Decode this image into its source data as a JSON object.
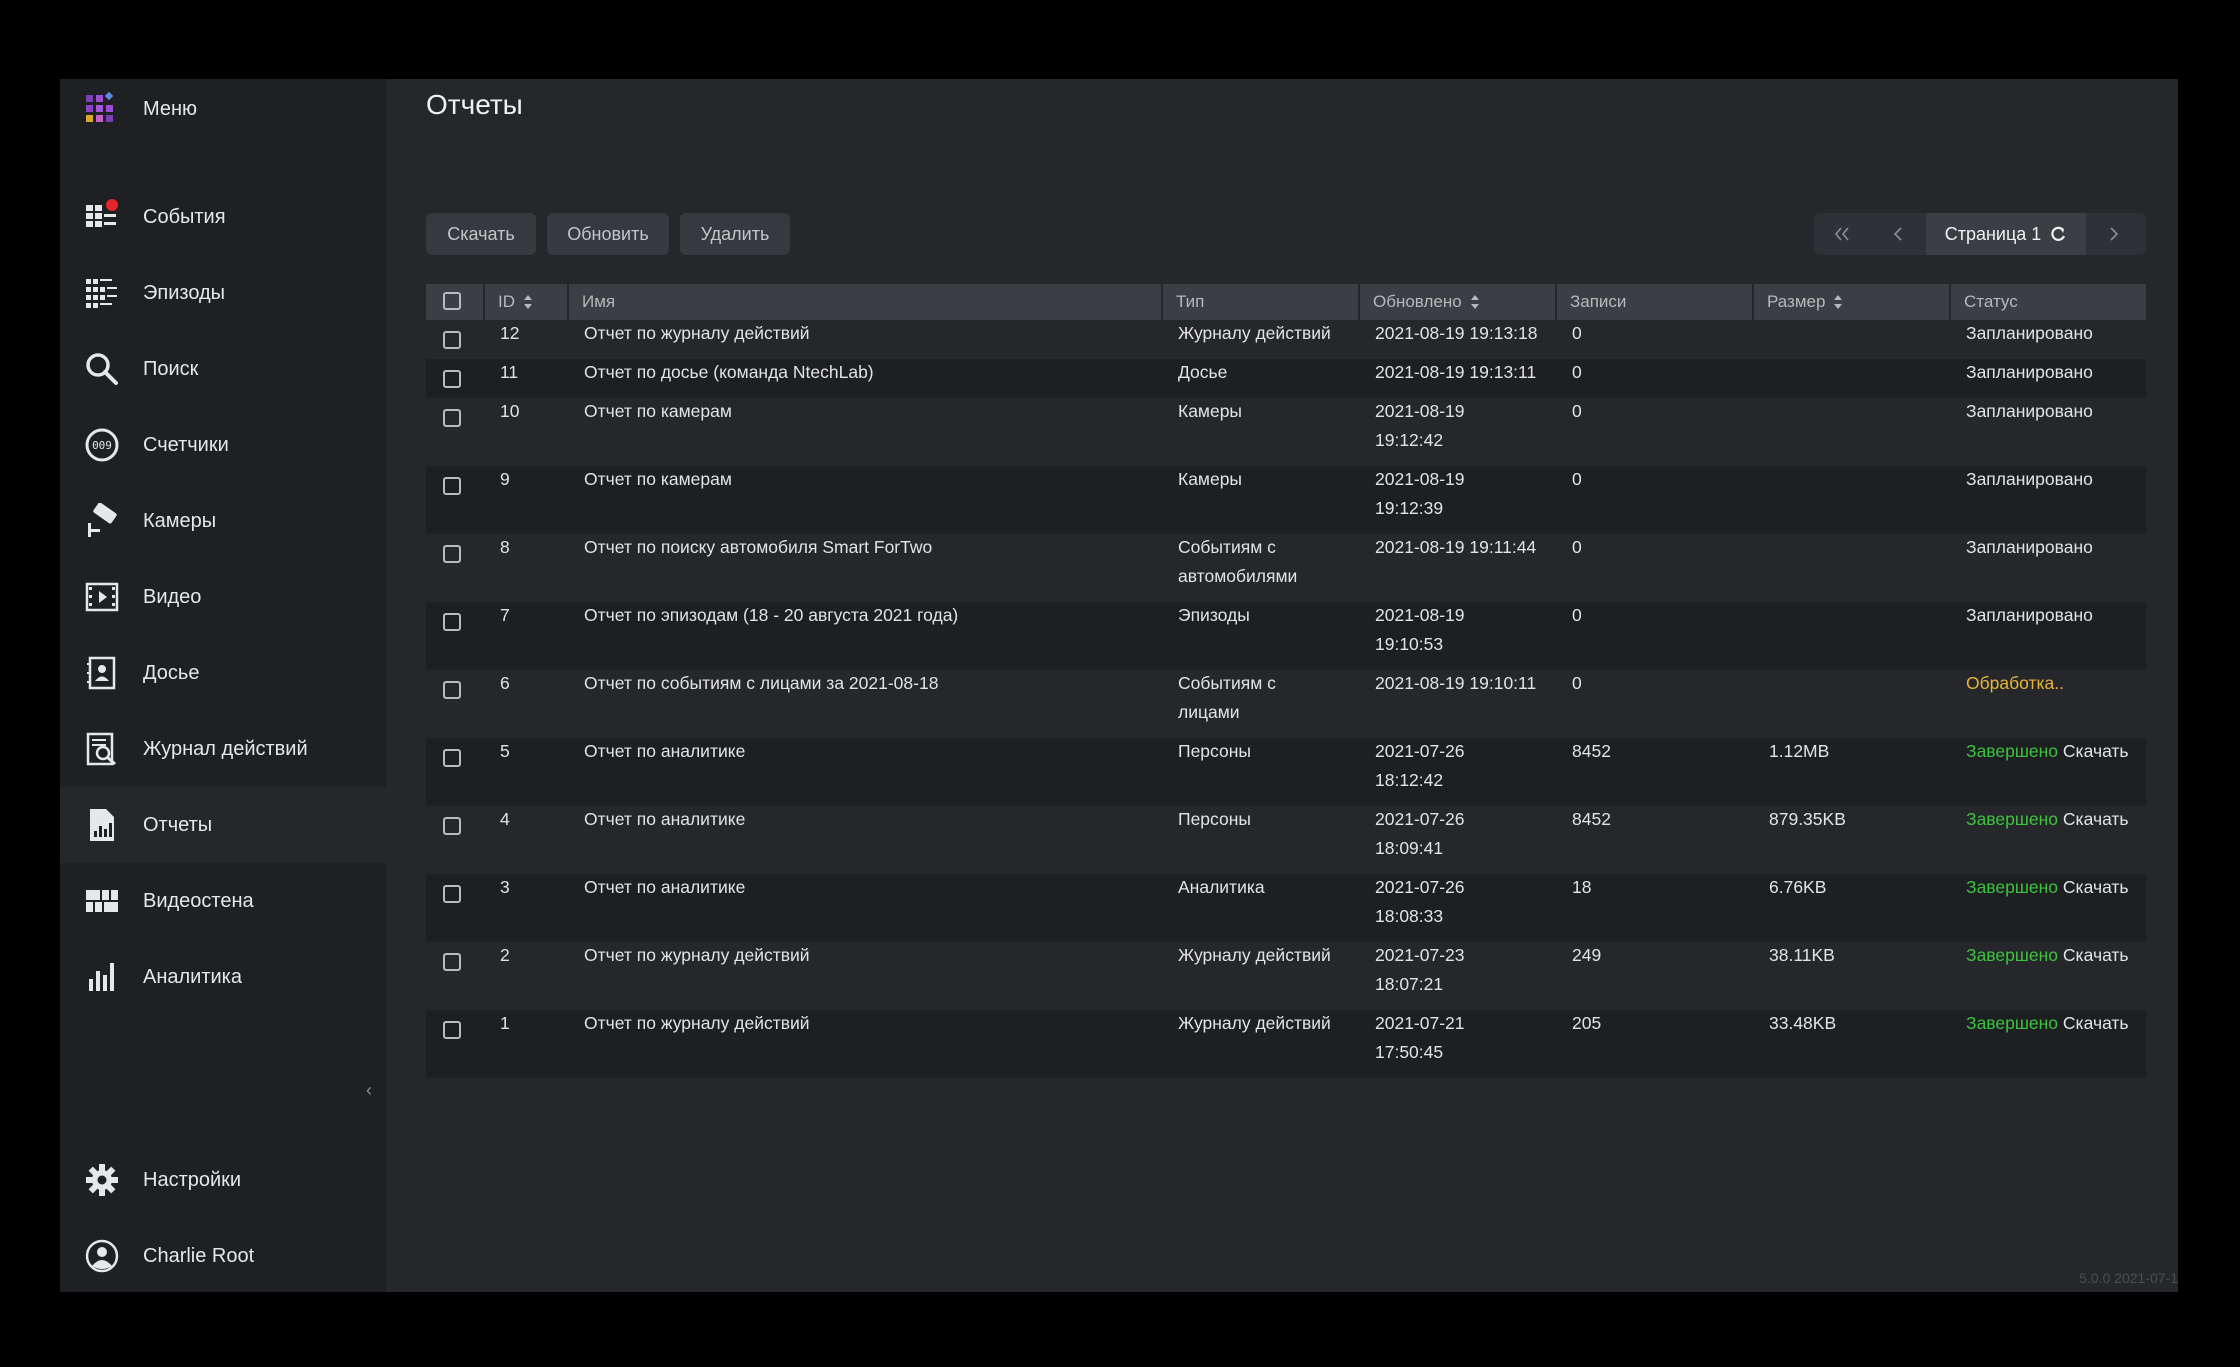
{
  "menu_label": "Меню",
  "sidebar": {
    "items": [
      {
        "key": "events",
        "label": "События",
        "icon": "events-grid-icon",
        "badge": true
      },
      {
        "key": "episodes",
        "label": "Эпизоды",
        "icon": "episodes-icon"
      },
      {
        "key": "search",
        "label": "Поиск",
        "icon": "search-icon"
      },
      {
        "key": "counters",
        "label": "Счетчики",
        "icon": "counter-icon"
      },
      {
        "key": "cameras",
        "label": "Камеры",
        "icon": "camera-icon"
      },
      {
        "key": "video",
        "label": "Видео",
        "icon": "film-icon"
      },
      {
        "key": "dossier",
        "label": "Досье",
        "icon": "dossier-icon"
      },
      {
        "key": "audit",
        "label": "Журнал действий",
        "icon": "audit-log-icon"
      },
      {
        "key": "reports",
        "label": "Отчеты",
        "icon": "report-icon",
        "active": true
      },
      {
        "key": "videowall",
        "label": "Видеостена",
        "icon": "videowall-icon"
      },
      {
        "key": "analytics",
        "label": "Аналитика",
        "icon": "bar-chart-icon"
      }
    ],
    "settings_label": "Настройки",
    "user_label": "Charlie Root"
  },
  "page_title": "Отчеты",
  "toolbar": {
    "download": "Скачать",
    "refresh": "Обновить",
    "delete": "Удалить"
  },
  "pager": {
    "current": "Страница 1"
  },
  "table": {
    "headers": {
      "id": "ID",
      "name": "Имя",
      "type": "Тип",
      "updated": "Обновлено",
      "records": "Записи",
      "size": "Размер",
      "status": "Статус"
    },
    "rows": [
      {
        "id": "12",
        "name": "Отчет по журналу действий",
        "type": [
          "Журналу действий"
        ],
        "updated": [
          "2021-08-19 19:13:18"
        ],
        "records": "0",
        "size": "",
        "status": "Запланировано",
        "status_kind": "planned",
        "link": ""
      },
      {
        "id": "11",
        "name": "Отчет по досье (команда NtechLab)",
        "type": [
          "Досье"
        ],
        "updated": [
          "2021-08-19 19:13:11"
        ],
        "records": "0",
        "size": "",
        "status": "Запланировано",
        "status_kind": "planned",
        "link": ""
      },
      {
        "id": "10",
        "name": "Отчет по камерам",
        "type": [
          "Камеры"
        ],
        "updated": [
          "2021-08-19",
          "19:12:42"
        ],
        "records": "0",
        "size": "",
        "status": "Запланировано",
        "status_kind": "planned",
        "link": ""
      },
      {
        "id": "9",
        "name": "Отчет по камерам",
        "type": [
          "Камеры"
        ],
        "updated": [
          "2021-08-19",
          "19:12:39"
        ],
        "records": "0",
        "size": "",
        "status": "Запланировано",
        "status_kind": "planned",
        "link": ""
      },
      {
        "id": "8",
        "name": "Отчет по поиску автомобиля Smart ForTwo",
        "type": [
          "Событиям с",
          "автомобилями"
        ],
        "updated": [
          "2021-08-19 19:11:44"
        ],
        "records": "0",
        "size": "",
        "status": "Запланировано",
        "status_kind": "planned",
        "link": ""
      },
      {
        "id": "7",
        "name": "Отчет по эпизодам (18 - 20 августа 2021 года)",
        "type": [
          "Эпизоды"
        ],
        "updated": [
          "2021-08-19",
          "19:10:53"
        ],
        "records": "0",
        "size": "",
        "status": "Запланировано",
        "status_kind": "planned",
        "link": ""
      },
      {
        "id": "6",
        "name": "Отчет по событиям с лицами за 2021-08-18",
        "type": [
          "Событиям с",
          "лицами"
        ],
        "updated": [
          "2021-08-19 19:10:11"
        ],
        "records": "0",
        "size": "",
        "status": "Обработка..",
        "status_kind": "processing",
        "link": ""
      },
      {
        "id": "5",
        "name": "Отчет по аналитике",
        "type": [
          "Персоны"
        ],
        "updated": [
          "2021-07-26",
          "18:12:42"
        ],
        "records": "8452",
        "size": "1.12MB",
        "status": "Завершено",
        "status_kind": "done",
        "link": "Скачать"
      },
      {
        "id": "4",
        "name": "Отчет по аналитике",
        "type": [
          "Персоны"
        ],
        "updated": [
          "2021-07-26",
          "18:09:41"
        ],
        "records": "8452",
        "size": "879.35KB",
        "status": "Завершено",
        "status_kind": "done",
        "link": "Скачать"
      },
      {
        "id": "3",
        "name": "Отчет по аналитике",
        "type": [
          "Аналитика"
        ],
        "updated": [
          "2021-07-26",
          "18:08:33"
        ],
        "records": "18",
        "size": "6.76KB",
        "status": "Завершено",
        "status_kind": "done",
        "link": "Скачать"
      },
      {
        "id": "2",
        "name": "Отчет по журналу действий",
        "type": [
          "Журналу действий"
        ],
        "updated": [
          "2021-07-23",
          "18:07:21"
        ],
        "records": "249",
        "size": "38.11KB",
        "status": "Завершено",
        "status_kind": "done",
        "link": "Скачать"
      },
      {
        "id": "1",
        "name": "Отчет по журналу действий",
        "type": [
          "Журналу действий"
        ],
        "updated": [
          "2021-07-21",
          "17:50:45"
        ],
        "records": "205",
        "size": "33.48KB",
        "status": "Завершено",
        "status_kind": "done",
        "link": "Скачать"
      }
    ]
  },
  "version": "5.0.0 2021-07-1",
  "colors": {
    "accent_red": "#e5252a",
    "done_green": "#3ec23f",
    "processing_yellow": "#e8b53a"
  }
}
